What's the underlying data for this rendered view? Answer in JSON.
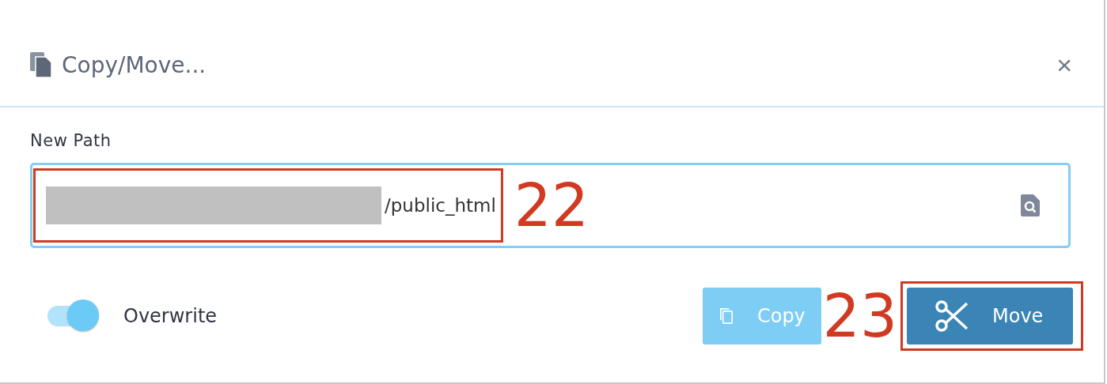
{
  "dialog": {
    "title": "Copy/Move...",
    "close": "×"
  },
  "path_field": {
    "label": "New Path",
    "value": "/public_html"
  },
  "overwrite": {
    "label": "Overwrite",
    "on": true
  },
  "buttons": [
    {
      "kind": "copy",
      "label": "Copy"
    },
    {
      "kind": "move",
      "label": "Move"
    }
  ],
  "annotations": [
    {
      "label": "22"
    },
    {
      "label": "23"
    }
  ]
}
